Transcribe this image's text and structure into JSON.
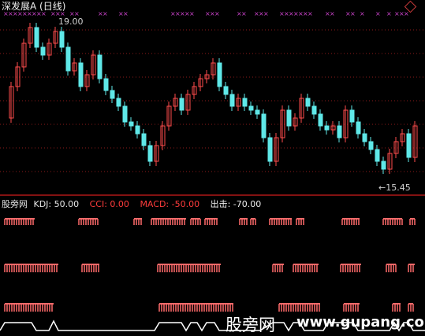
{
  "window": {
    "title": "深发展A (日线)"
  },
  "price_panel": {
    "high_label": "19.00",
    "low_label": "←15.45"
  },
  "indicator_bar": {
    "source": "股旁网",
    "kdj": "KDJ: 50.00",
    "cci": "CCI: 0.00",
    "macd": "MACD: -50.00",
    "exit": "出击: -70.00"
  },
  "colors": {
    "background": "#000000",
    "up_candle": "#ff4d4d",
    "down_candle": "#5fe8e8",
    "signal_marker": "#cc44cc",
    "grid": "#8b1a1a",
    "separator": "#b01818",
    "kdj_label": "#e6e6e6",
    "cci_label": "#ff3c3c",
    "macd_label": "#ff3c3c",
    "exit_label": "#f0f0f0",
    "signal_bar": "#ff6a6a",
    "envelope_line": "#ffffff"
  },
  "watermark": {
    "text_cn": "股旁网",
    "url": "www.gupang.com"
  }
}
